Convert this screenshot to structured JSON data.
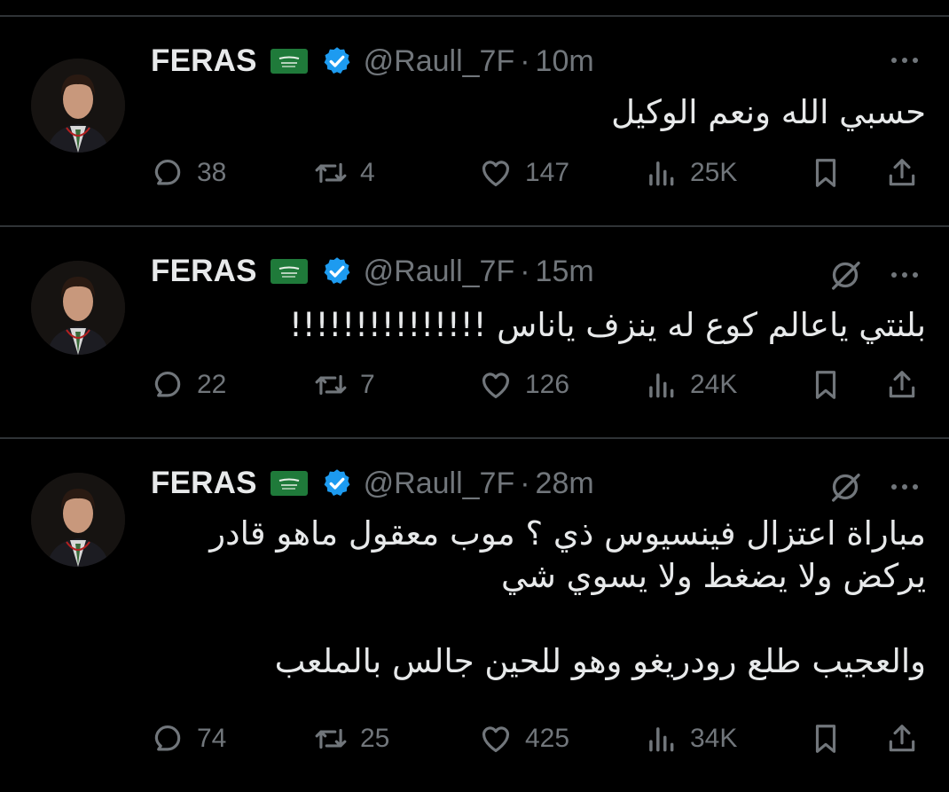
{
  "tweets": [
    {
      "name": "FERAS",
      "handle": "@Raull_7F",
      "separator": "·",
      "time": "10m",
      "has_grok": false,
      "text": [
        "حسبي الله ونعم الوكيل"
      ],
      "replies": "38",
      "reposts": "4",
      "likes": "147",
      "views": "25K"
    },
    {
      "name": "FERAS",
      "handle": "@Raull_7F",
      "separator": "·",
      "time": "15m",
      "has_grok": true,
      "text": [
        "بلنتي ياعالم كوع له ينزف ياناس !!!!!!!!!!!!!!!"
      ],
      "replies": "22",
      "reposts": "7",
      "likes": "126",
      "views": "24K"
    },
    {
      "name": "FERAS",
      "handle": "@Raull_7F",
      "separator": "·",
      "time": "28m",
      "has_grok": true,
      "text": [
        "مباراة اعتزال فينسيوس ذي ؟ موب معقول ماهو قادر",
        "يركض ولا يضغط ولا يسوي شي",
        "",
        "والعجيب طلع رودريغو وهو للحين جالس بالملعب"
      ],
      "replies": "74",
      "reposts": "25",
      "likes": "425",
      "views": "34K"
    }
  ],
  "icons": {
    "flag": "saudi-flag-icon",
    "verified": "verified-badge-icon",
    "grok": "grok-icon",
    "more": "more-icon",
    "reply": "reply-icon",
    "repost": "repost-icon",
    "like": "like-icon",
    "views": "views-icon",
    "bookmark": "bookmark-icon",
    "share": "share-icon"
  },
  "colors": {
    "background": "#000000",
    "text": "#e7e9ea",
    "muted": "#71767b",
    "verified": "#1d9bf0",
    "flag_green": "#1f7a3a",
    "divider": "#2f3336"
  }
}
